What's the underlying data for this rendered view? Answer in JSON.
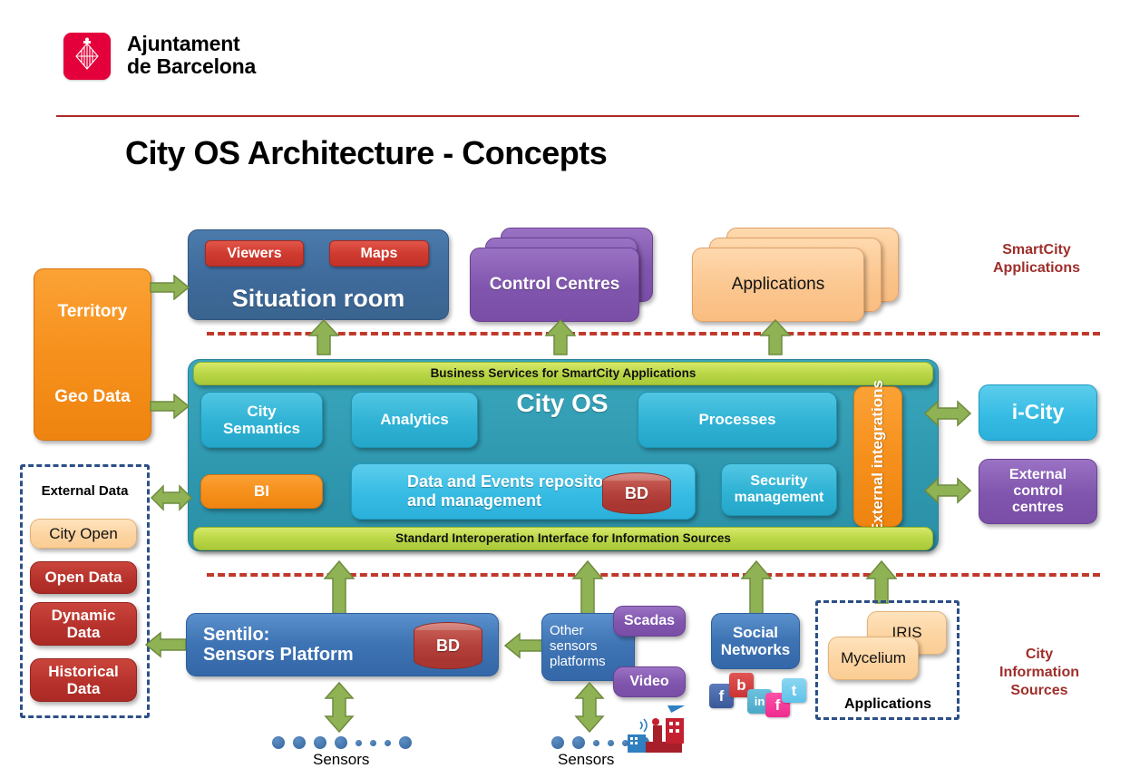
{
  "header": {
    "logo_line1": "Ajuntament",
    "logo_line2": "de Barcelona",
    "logo_icon": "barcelona-coat-of-arms-icon",
    "title": "City OS Architecture - Concepts"
  },
  "side_labels": {
    "smartcity_applications": "SmartCity\nApplications",
    "smartcity_applications_l1": "SmartCity",
    "smartcity_applications_l2": "Applications",
    "city_information_sources_l1": "City",
    "city_information_sources_l2": "Information",
    "city_information_sources_l3": "Sources"
  },
  "top_row": {
    "situation_room": {
      "title": "Situation room",
      "buttons": [
        {
          "label": "Viewers"
        },
        {
          "label": "Maps"
        }
      ]
    },
    "control_centres": "Control Centres",
    "applications": "Applications"
  },
  "cityos": {
    "top_bar": "Business Services for SmartCity Applications",
    "bottom_bar": "Standard Interoperation Interface for Information Sources",
    "center_label": "City OS",
    "modules": {
      "city_semantics_l1": "City",
      "city_semantics_l2": "Semantics",
      "analytics": "Analytics",
      "processes": "Processes",
      "bi": "BI",
      "repository_l1": "Data and Events repository",
      "repository_l2": "and management",
      "repository_db": "BD",
      "security_l1": "Security",
      "security_l2": "management",
      "external_integrations": "External integrations"
    }
  },
  "right_column": {
    "icity": "i-City",
    "external_control_centres_l1": "External",
    "external_control_centres_l2": "control",
    "external_control_centres_l3": "centres"
  },
  "left_column": {
    "territory_l1": "Territory",
    "territory_l2": "Geo Data",
    "external_data_title": "External Data",
    "items": [
      {
        "label": "City Open"
      },
      {
        "label": "Open Data"
      },
      {
        "label": "Dynamic Data"
      },
      {
        "label": "Historical Data"
      }
    ],
    "city_open": "City Open",
    "open_data": "Open Data",
    "dynamic_data_l1": "Dynamic",
    "dynamic_data_l2": "Data",
    "historical_data_l1": "Historical",
    "historical_data_l2": "Data"
  },
  "bottom_row": {
    "sentilo_l1": "Sentilo:",
    "sentilo_l2": "Sensors Platform",
    "sentilo_db": "BD",
    "other_sensors_l1": "Other",
    "other_sensors_l2": "sensors",
    "other_sensors_l3": "platforms",
    "scadas": "Scadas",
    "video": "Video",
    "social_networks_l1": "Social",
    "social_networks_l2": "Networks",
    "social_icons": [
      {
        "name": "facebook-icon",
        "glyph": "f",
        "color": "#3b5998"
      },
      {
        "name": "blogger-icon",
        "glyph": "b",
        "color": "#cc3333"
      },
      {
        "name": "linkedin-icon",
        "glyph": "in",
        "color": "#4aa8c9"
      },
      {
        "name": "flickr-icon",
        "glyph": "f",
        "color": "#ef2b8f"
      },
      {
        "name": "twitter-icon",
        "glyph": "t",
        "color": "#5fc3e8"
      }
    ],
    "sensors_label_1": "Sensors",
    "sensors_label_2": "Sensors",
    "apps_group_label": "Applications",
    "iris": "IRIS",
    "mycelium": "Mycelium"
  },
  "colors": {
    "accent_red": "#9e2e2a",
    "logo_red": "#e4003a",
    "divider_red": "#c0392b",
    "arrow_green": "#8aab4a",
    "teal": "#2e97ae",
    "orange": "#f6901c",
    "purple": "#8055ad",
    "peach": "#fbc68f",
    "group_border_blue": "#2c4f87"
  }
}
